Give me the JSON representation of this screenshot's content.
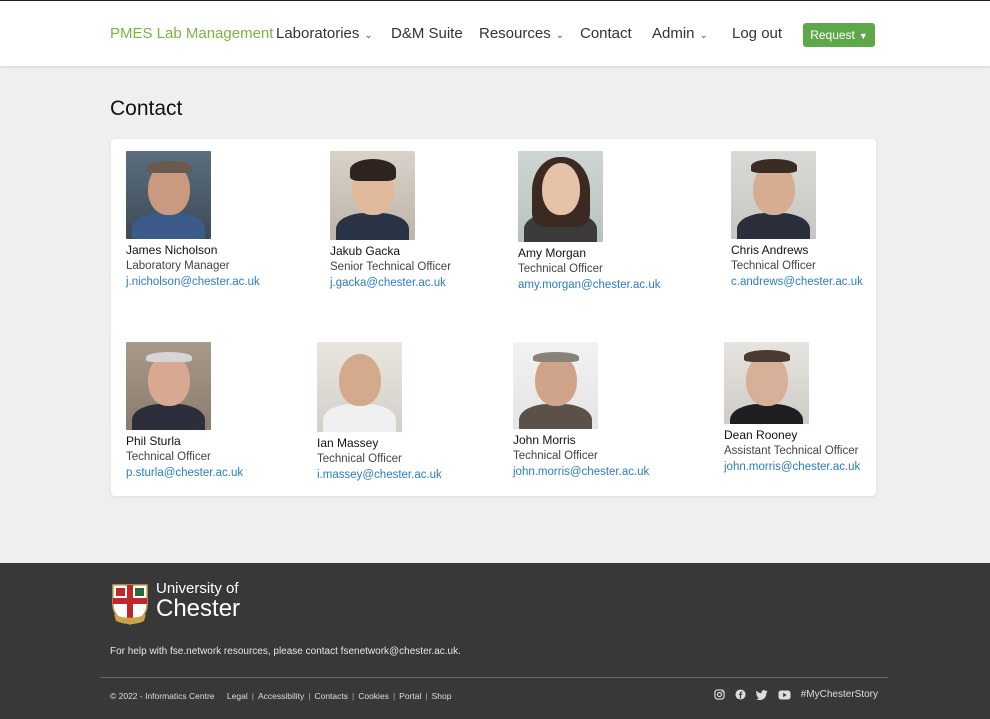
{
  "nav": {
    "brand": "PMES Lab Management",
    "items": [
      {
        "label": "Laboratories",
        "dropdown": true
      },
      {
        "label": "D&M Suite",
        "dropdown": false
      },
      {
        "label": "Resources",
        "dropdown": true
      },
      {
        "label": "Contact",
        "dropdown": false
      },
      {
        "label": "Admin",
        "dropdown": true
      },
      {
        "label": "Log out",
        "dropdown": false
      }
    ],
    "request_label": "Request"
  },
  "page": {
    "title": "Contact"
  },
  "contacts": [
    {
      "name": "James Nicholson",
      "role": "Laboratory Manager",
      "email": "j.nicholson@chester.ac.uk"
    },
    {
      "name": "Jakub Gacka",
      "role": "Senior Technical Officer",
      "email": "j.gacka@chester.ac.uk"
    },
    {
      "name": "Amy Morgan",
      "role": "Technical Officer",
      "email": "amy.morgan@chester.ac.uk"
    },
    {
      "name": "Chris Andrews",
      "role": "Technical Officer",
      "email": "c.andrews@chester.ac.uk"
    },
    {
      "name": "Phil Sturla",
      "role": "Technical Officer",
      "email": "p.sturla@chester.ac.uk"
    },
    {
      "name": "Ian Massey",
      "role": "Technical Officer",
      "email": "i.massey@chester.ac.uk"
    },
    {
      "name": "John Morris",
      "role": "Technical Officer",
      "email": "john.morris@chester.ac.uk"
    },
    {
      "name": "Dean Rooney",
      "role": "Assistant Technical Officer",
      "email": "john.morris@chester.ac.uk"
    }
  ],
  "footer": {
    "logo_line1": "University of",
    "logo_line2": "Chester",
    "help_text": "For help with fse.network resources, please contact ",
    "help_email": "fsenetwork@chester.ac.uk",
    "help_end": ".",
    "copyright": "© 2022 - Informatics Centre",
    "links": [
      "Legal",
      "Accessibility",
      "Contacts",
      "Cookies",
      "Portal",
      "Shop"
    ],
    "hashtag": "#MyChesterStory"
  },
  "colors": {
    "brand_green": "#7cb342",
    "button_green": "#5fa84a",
    "link_blue": "#2d7cc1",
    "footer_bg": "#383838"
  }
}
